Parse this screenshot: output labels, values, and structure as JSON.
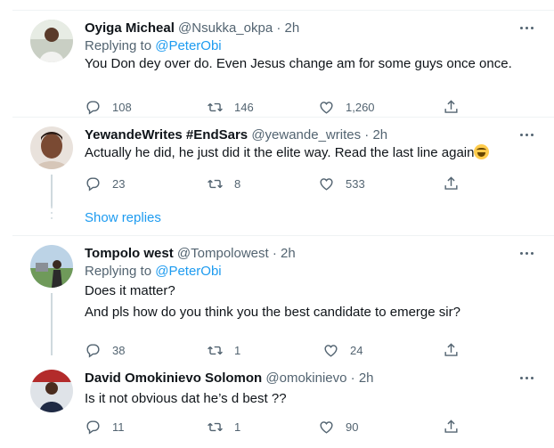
{
  "tweets": [
    {
      "name": "Oyiga Micheal",
      "handle": "@Nsukka_okpa",
      "time": "· 2h",
      "replying_label": "Replying to",
      "replying_handle": "@PeterObi",
      "lines": [
        "You Don dey over do. Even Jesus change am for some guys once once."
      ],
      "replies": "108",
      "retweets": "146",
      "likes": "1,260"
    },
    {
      "name": "YewandeWrites #EndSars",
      "handle": "@yewande_writes",
      "time": "· 2h",
      "lines": [
        "Actually he did, he just did it the elite way. Read the last line again"
      ],
      "emoji": "face-with-tears-of-joy",
      "replies": "23",
      "retweets": "8",
      "likes": "533"
    },
    {
      "name": "Tompolo west",
      "handle": "@Tompolowest",
      "time": "· 2h",
      "replying_label": "Replying to",
      "replying_handle": "@PeterObi",
      "lines": [
        "Does it matter?",
        "And pls how do you think you the best candidate to emerge sir?"
      ],
      "replies": "38",
      "retweets": "1",
      "likes": "24"
    },
    {
      "name": "David Omokinievo Solomon",
      "handle": "@omokinievo",
      "time": "· 2h",
      "lines": [
        "Is it not obvious dat he’s d best ??"
      ],
      "replies": "11",
      "retweets": "1",
      "likes": "90"
    }
  ],
  "show_replies": "Show replies",
  "colors": {
    "accent": "#1d9bf0",
    "muted": "#536471",
    "text": "#0f1419",
    "border": "#eff3f4"
  },
  "icons": [
    "reply-icon",
    "retweet-icon",
    "like-icon",
    "share-icon",
    "more-icon"
  ]
}
